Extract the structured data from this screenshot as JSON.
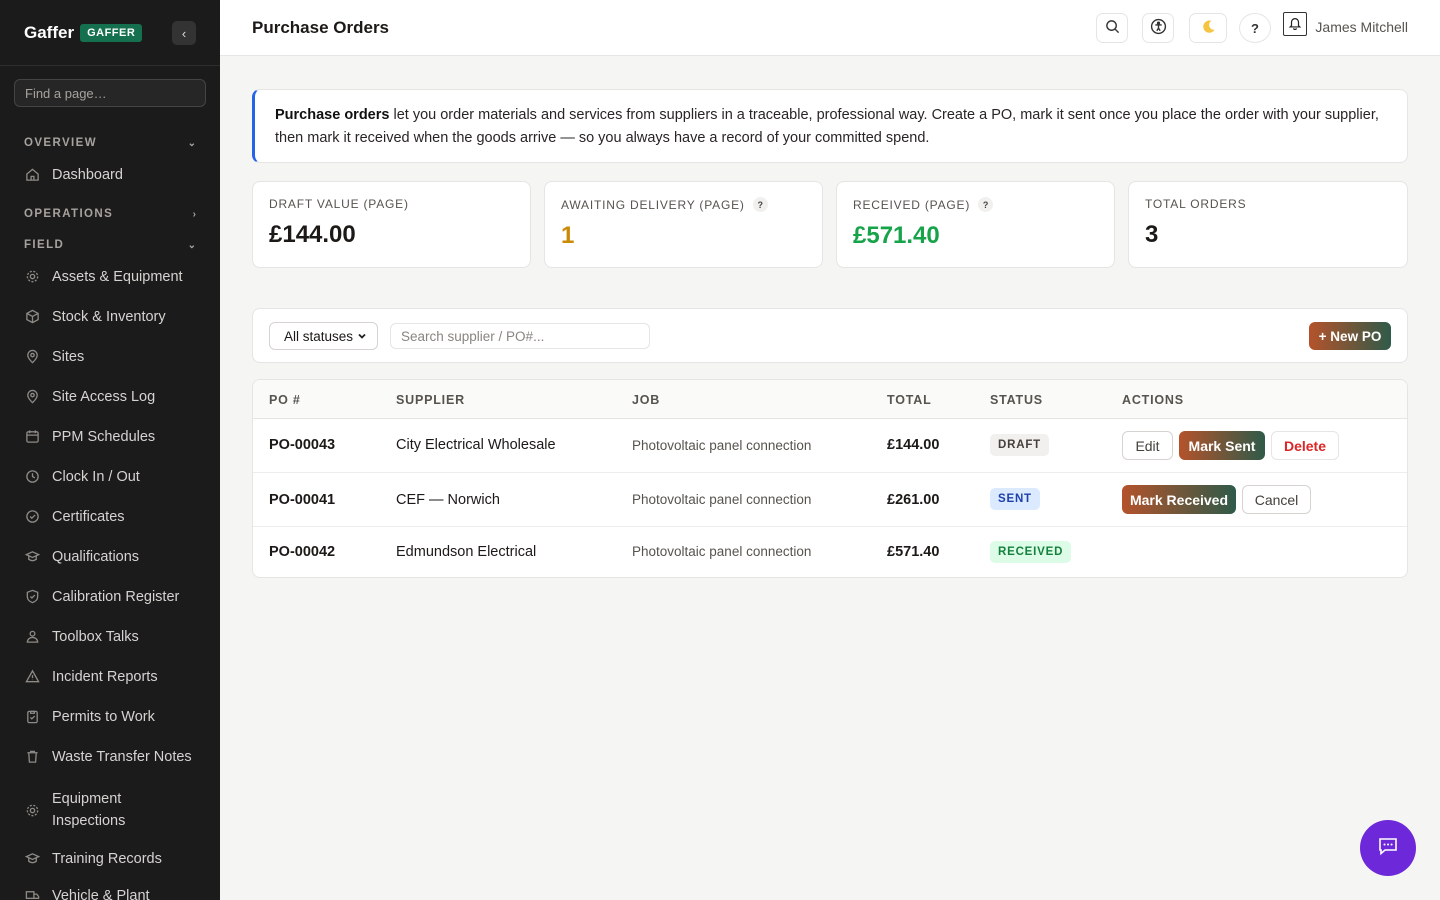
{
  "brand": {
    "name": "Gaffer",
    "badge": "GAFFER"
  },
  "sidebar": {
    "search_placeholder": "Find a page…",
    "sections": [
      {
        "label": "OVERVIEW",
        "chevron": "⌄"
      },
      {
        "label": "OPERATIONS",
        "chevron": "›"
      },
      {
        "label": "FIELD",
        "chevron": "⌄"
      }
    ],
    "items": [
      {
        "label": "Dashboard",
        "icon": "home-icon"
      },
      {
        "label": "Assets & Equipment",
        "icon": "gear-icon"
      },
      {
        "label": "Stock & Inventory",
        "icon": "box-icon"
      },
      {
        "label": "Sites",
        "icon": "location-icon"
      },
      {
        "label": "Site Access Log",
        "icon": "location-icon"
      },
      {
        "label": "PPM Schedules",
        "icon": "calendar-icon"
      },
      {
        "label": "Clock In / Out",
        "icon": "clock-icon"
      },
      {
        "label": "Certificates",
        "icon": "check-circle-icon"
      },
      {
        "label": "Qualifications",
        "icon": "graduation-icon"
      },
      {
        "label": "Calibration Register",
        "icon": "shield-icon"
      },
      {
        "label": "Toolbox Talks",
        "icon": "users-icon"
      },
      {
        "label": "Incident Reports",
        "icon": "warning-icon"
      },
      {
        "label": "Permits to Work",
        "icon": "clipboard-icon"
      },
      {
        "label": "Waste Transfer Notes",
        "icon": "trash-icon"
      },
      {
        "label": "Equipment",
        "label2": "Inspections",
        "icon": "gear-icon"
      },
      {
        "label": "Training Records",
        "icon": "graduation-icon"
      },
      {
        "label": "Vehicle & Plant",
        "icon": "truck-icon"
      }
    ]
  },
  "header": {
    "title": "Purchase Orders",
    "user": "James Mitchell"
  },
  "info": {
    "bold": "Purchase orders",
    "text": " let you order materials and services from suppliers in a traceable, professional way. Create a PO, mark it sent once you place the order with your supplier, then mark it received when the goods arrive — so you always have a record of your committed spend."
  },
  "stats": [
    {
      "label": "DRAFT VALUE (PAGE)",
      "value": "£144.00",
      "color": "#1c1917",
      "help": ""
    },
    {
      "label": "AWAITING DELIVERY (PAGE)",
      "value": "1",
      "color": "#ca8a04",
      "help": "?"
    },
    {
      "label": "RECEIVED (PAGE)",
      "value": "£571.40",
      "color": "#16a34a",
      "help": "?"
    },
    {
      "label": "TOTAL ORDERS",
      "value": "3",
      "color": "#1c1917",
      "help": ""
    }
  ],
  "filters": {
    "status_value": "All statuses",
    "search_placeholder": "Search supplier / PO#...",
    "new_label": "+ New PO"
  },
  "table": {
    "columns": [
      "PO #",
      "SUPPLIER",
      "JOB",
      "TOTAL",
      "STATUS",
      "ACTIONS"
    ],
    "rows": [
      {
        "po": "PO-00043",
        "supplier": "City Electrical Wholesale",
        "job": "Photovoltaic panel connection",
        "total": "£144.00",
        "status": "DRAFT",
        "actions": [
          "Edit",
          "Mark Sent",
          "Delete"
        ]
      },
      {
        "po": "PO-00041",
        "supplier": "CEF — Norwich",
        "job": "Photovoltaic panel connection",
        "total": "£261.00",
        "status": "SENT",
        "actions": [
          "Mark Received",
          "Cancel"
        ]
      },
      {
        "po": "PO-00042",
        "supplier": "Edmundson Electrical",
        "job": "Photovoltaic panel connection",
        "total": "£571.40",
        "status": "RECEIVED",
        "actions": []
      }
    ]
  },
  "colors": {
    "accent_from": "#b4532b",
    "accent_to": "#2f5a49",
    "info_border": "#2563eb",
    "chat": "#6d28d9"
  }
}
